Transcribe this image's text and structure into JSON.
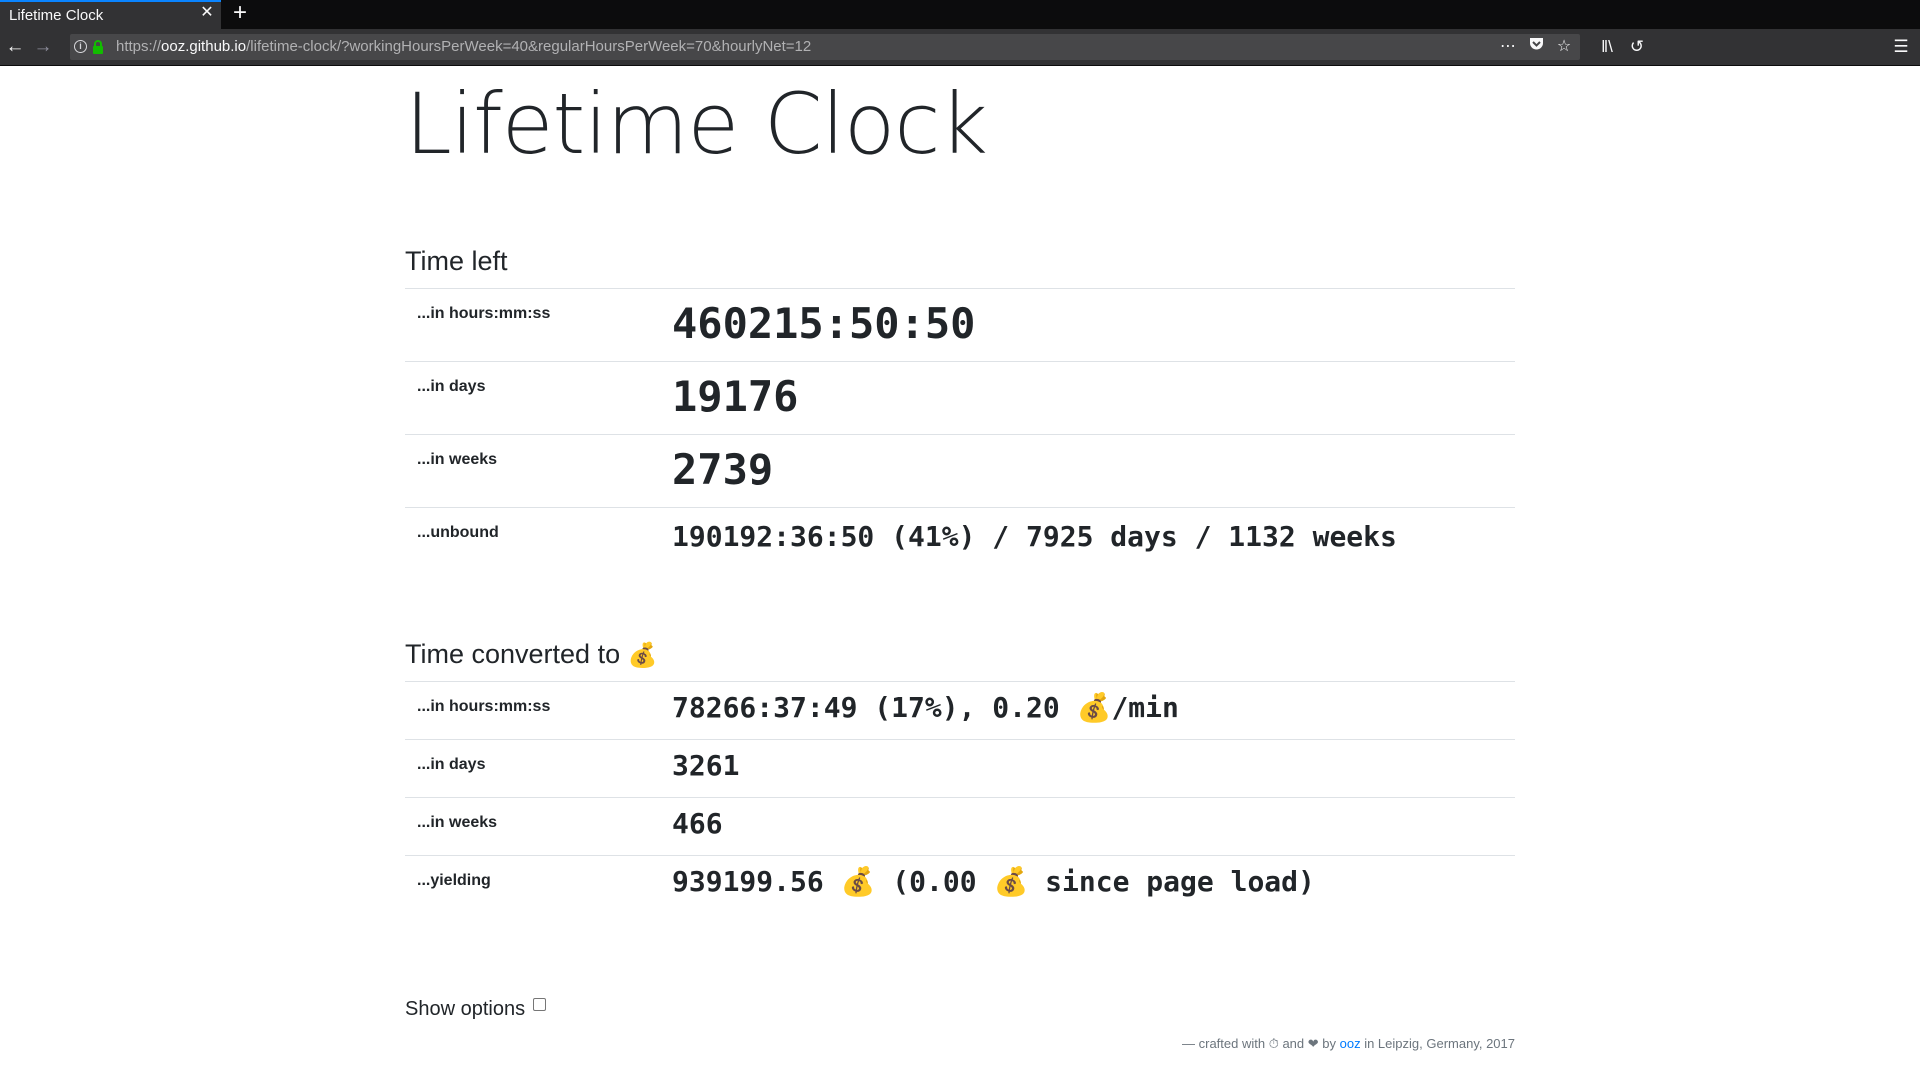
{
  "browser": {
    "tab_title": "Lifetime Clock",
    "tab_close_glyph": "✕",
    "new_tab_glyph": "+",
    "url_protocol": "https://",
    "url_host": "ooz.github.io",
    "url_path": "/lifetime-clock/?workingHoursPerWeek=40&regularHoursPerWeek=70&hourlyNet=12",
    "icons": [
      "back-icon",
      "forward-icon",
      "info-icon",
      "lock-icon",
      "page-actions-icon",
      "pocket-icon",
      "bookmark-star-icon",
      "library-icon",
      "history-icon",
      "menu-icon"
    ]
  },
  "page": {
    "title": "Lifetime Clock",
    "time_left": {
      "heading": "Time left",
      "rows": [
        {
          "label": "...in hours:mm:ss",
          "value": "460215:50:50"
        },
        {
          "label": "...in days",
          "value": "19176"
        },
        {
          "label": "...in weeks",
          "value": "2739"
        },
        {
          "label": "...unbound",
          "value": "190192:36:50 (41%) / 7925 days / 1132 weeks"
        }
      ]
    },
    "time_converted": {
      "heading": "Time converted to",
      "heading_icon": "💰",
      "rows": [
        {
          "label": "...in hours:mm:ss",
          "value": "78266:37:49 (17%), 0.20 💰/min"
        },
        {
          "label": "...in days",
          "value": "3261"
        },
        {
          "label": "...in weeks",
          "value": "466"
        },
        {
          "label": "...yielding",
          "value": "939199.56 💰 (0.00 💰 since page load)"
        }
      ]
    },
    "options_label": "Show options",
    "footer": {
      "prefix": "— crafted with ⏱ and ❤ by",
      "author": "ooz",
      "suffix": "in Leipzig, Germany, 2017"
    }
  }
}
